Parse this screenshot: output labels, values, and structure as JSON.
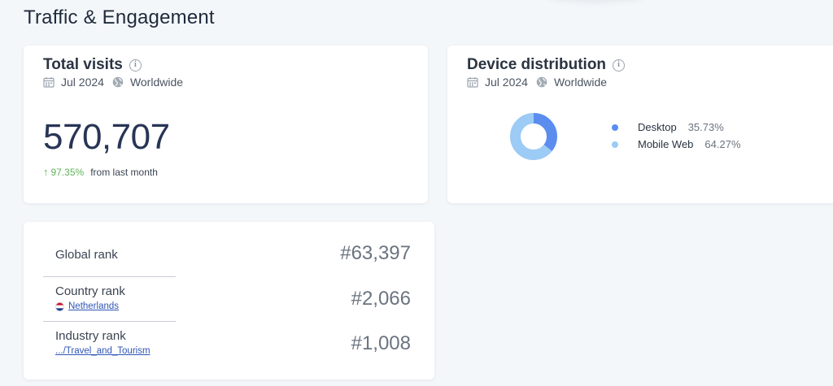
{
  "page": {
    "title": "Traffic & Engagement"
  },
  "visits": {
    "title": "Total visits",
    "period": "Jul 2024",
    "region": "Worldwide",
    "value": "570,707",
    "change": "97.35%",
    "change_note": "from last month",
    "change_direction": "up"
  },
  "devices": {
    "title": "Device distribution",
    "period": "Jul 2024",
    "region": "Worldwide",
    "items": [
      {
        "label": "Desktop",
        "value": "35.73%",
        "share": 35.73,
        "color": "#5b8def"
      },
      {
        "label": "Mobile Web",
        "value": "64.27%",
        "share": 64.27,
        "color": "#9ccbf5"
      }
    ]
  },
  "ranks": {
    "global": {
      "label": "Global rank",
      "value": "#63,397"
    },
    "country": {
      "label": "Country rank",
      "value": "#2,066",
      "link": "Netherlands"
    },
    "industry": {
      "label": "Industry rank",
      "value": "#1,008",
      "link": ".../Travel_and_Tourism"
    }
  },
  "colors": {
    "accent": "#5b8def",
    "accent_light": "#9ccbf5",
    "positive": "#5fb35a",
    "link": "#2f55b5",
    "headline": "#283556"
  },
  "icons": [
    "info-icon",
    "calendar-icon",
    "globe-icon",
    "arrow-up-icon",
    "netherlands-flag-icon"
  ]
}
